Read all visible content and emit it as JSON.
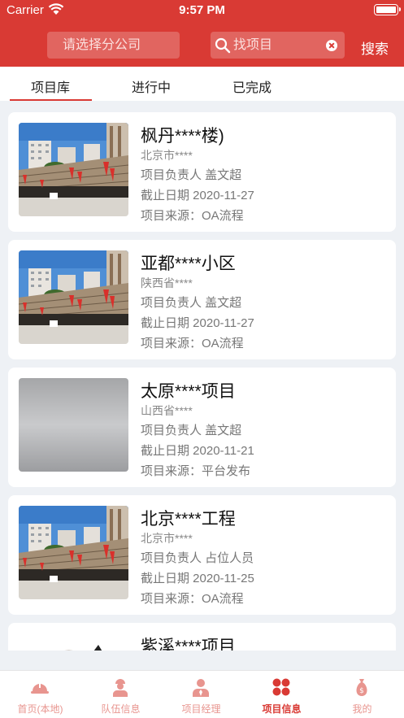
{
  "status_bar": {
    "carrier": "Carrier",
    "time": "9:57 PM"
  },
  "header": {
    "company_placeholder": "请选择分公司",
    "search_placeholder": "找项目",
    "search_button": "搜索"
  },
  "tabs": [
    {
      "label": "项目库",
      "active": true
    },
    {
      "label": "进行中",
      "active": false
    },
    {
      "label": "已完成",
      "active": false
    }
  ],
  "projects": [
    {
      "title": "枫丹****楼)",
      "region": "北京市****",
      "leader": "项目负责人 盖文超",
      "deadline": "截止日期 2020-11-27",
      "source": "项目来源：OA流程",
      "image": "building-photo"
    },
    {
      "title": "亚都****小区",
      "region": "陕西省****",
      "leader": "项目负责人 盖文超",
      "deadline": "截止日期 2020-11-27",
      "source": "项目来源：OA流程",
      "image": "building-photo"
    },
    {
      "title": "太原****项目",
      "region": "山西省****",
      "leader": "项目负责人 盖文超",
      "deadline": "截止日期 2020-11-21",
      "source": "项目来源：平台发布",
      "image": "gray-placeholder"
    },
    {
      "title": "北京****工程",
      "region": "北京市****",
      "leader": "项目负责人 占位人员",
      "deadline": "截止日期 2020-11-25",
      "source": "项目来源：OA流程",
      "image": "building-photo"
    },
    {
      "title": "紫溪****项目",
      "image": "sketch-photo"
    }
  ],
  "tabbar": [
    {
      "label": "首页(本地)",
      "icon": "helmet-icon",
      "active": false
    },
    {
      "label": "队伍信息",
      "icon": "worker-icon",
      "active": false
    },
    {
      "label": "项目经理",
      "icon": "manager-icon",
      "active": false
    },
    {
      "label": "项目信息",
      "icon": "grid-icon",
      "active": true
    },
    {
      "label": "我的",
      "icon": "money-bag-icon",
      "active": false
    }
  ],
  "colors": {
    "brand": "#d93a34",
    "background": "#eef1f5",
    "inactive_tab": "#e8958f"
  }
}
